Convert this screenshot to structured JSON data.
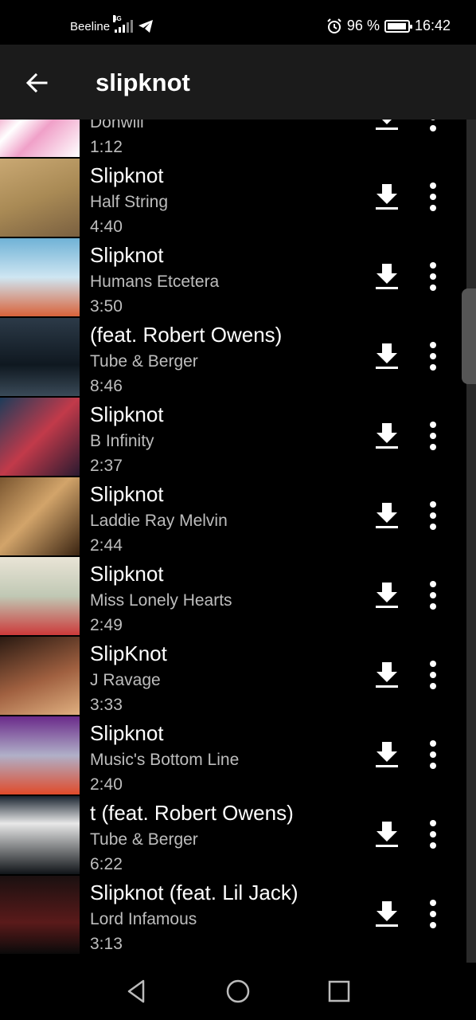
{
  "status_bar": {
    "carrier": "Beeline",
    "network": "4G",
    "alarm_icon": "alarm-icon",
    "battery_percent": "96 %",
    "battery_level": 0.96,
    "time": "16:42"
  },
  "app_bar": {
    "title": "slipknot"
  },
  "tracks": [
    {
      "title": "",
      "artist": "Donwill",
      "duration": "1:12"
    },
    {
      "title": "Slipknot",
      "artist": "Half String",
      "duration": "4:40"
    },
    {
      "title": "Slipknot",
      "artist": "Humans Etcetera",
      "duration": "3:50"
    },
    {
      "title": "(feat. Robert Owens)",
      "artist": "Tube & Berger",
      "duration": "8:46"
    },
    {
      "title": "Slipknot",
      "artist": "B Infinity",
      "duration": "2:37"
    },
    {
      "title": "Slipknot",
      "artist": "Laddie Ray Melvin",
      "duration": "2:44"
    },
    {
      "title": "Slipknot",
      "artist": "Miss Lonely Hearts",
      "duration": "2:49"
    },
    {
      "title": "SlipKnot",
      "artist": "J Ravage",
      "duration": "3:33"
    },
    {
      "title": "Slipknot",
      "artist": "Music's Bottom Line",
      "duration": "2:40"
    },
    {
      "title": "t (feat. Robert Owens)",
      "artist": "Tube & Berger",
      "duration": "6:22"
    },
    {
      "title": "Slipknot (feat. Lil Jack)",
      "artist": "Lord Infamous",
      "duration": "3:13"
    }
  ],
  "colors": {
    "background": "#000000",
    "app_bar": "#1b1b1b",
    "secondary_text": "#bdbdbd",
    "icon": "#ffffff"
  }
}
